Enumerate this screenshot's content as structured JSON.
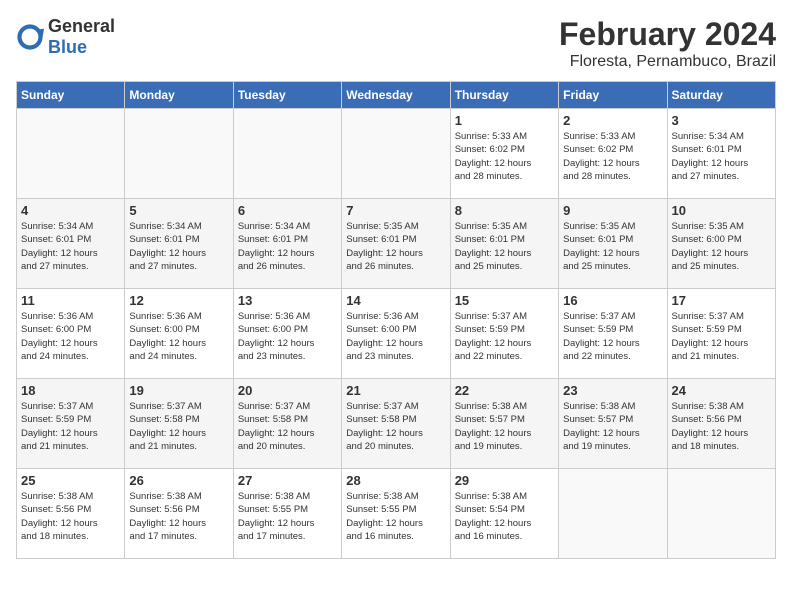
{
  "header": {
    "logo_general": "General",
    "logo_blue": "Blue",
    "month_year": "February 2024",
    "location": "Floresta, Pernambuco, Brazil"
  },
  "days_of_week": [
    "Sunday",
    "Monday",
    "Tuesday",
    "Wednesday",
    "Thursday",
    "Friday",
    "Saturday"
  ],
  "weeks": [
    [
      {
        "day": "",
        "info": ""
      },
      {
        "day": "",
        "info": ""
      },
      {
        "day": "",
        "info": ""
      },
      {
        "day": "",
        "info": ""
      },
      {
        "day": "1",
        "info": "Sunrise: 5:33 AM\nSunset: 6:02 PM\nDaylight: 12 hours\nand 28 minutes."
      },
      {
        "day": "2",
        "info": "Sunrise: 5:33 AM\nSunset: 6:02 PM\nDaylight: 12 hours\nand 28 minutes."
      },
      {
        "day": "3",
        "info": "Sunrise: 5:34 AM\nSunset: 6:01 PM\nDaylight: 12 hours\nand 27 minutes."
      }
    ],
    [
      {
        "day": "4",
        "info": "Sunrise: 5:34 AM\nSunset: 6:01 PM\nDaylight: 12 hours\nand 27 minutes."
      },
      {
        "day": "5",
        "info": "Sunrise: 5:34 AM\nSunset: 6:01 PM\nDaylight: 12 hours\nand 27 minutes."
      },
      {
        "day": "6",
        "info": "Sunrise: 5:34 AM\nSunset: 6:01 PM\nDaylight: 12 hours\nand 26 minutes."
      },
      {
        "day": "7",
        "info": "Sunrise: 5:35 AM\nSunset: 6:01 PM\nDaylight: 12 hours\nand 26 minutes."
      },
      {
        "day": "8",
        "info": "Sunrise: 5:35 AM\nSunset: 6:01 PM\nDaylight: 12 hours\nand 25 minutes."
      },
      {
        "day": "9",
        "info": "Sunrise: 5:35 AM\nSunset: 6:01 PM\nDaylight: 12 hours\nand 25 minutes."
      },
      {
        "day": "10",
        "info": "Sunrise: 5:35 AM\nSunset: 6:00 PM\nDaylight: 12 hours\nand 25 minutes."
      }
    ],
    [
      {
        "day": "11",
        "info": "Sunrise: 5:36 AM\nSunset: 6:00 PM\nDaylight: 12 hours\nand 24 minutes."
      },
      {
        "day": "12",
        "info": "Sunrise: 5:36 AM\nSunset: 6:00 PM\nDaylight: 12 hours\nand 24 minutes."
      },
      {
        "day": "13",
        "info": "Sunrise: 5:36 AM\nSunset: 6:00 PM\nDaylight: 12 hours\nand 23 minutes."
      },
      {
        "day": "14",
        "info": "Sunrise: 5:36 AM\nSunset: 6:00 PM\nDaylight: 12 hours\nand 23 minutes."
      },
      {
        "day": "15",
        "info": "Sunrise: 5:37 AM\nSunset: 5:59 PM\nDaylight: 12 hours\nand 22 minutes."
      },
      {
        "day": "16",
        "info": "Sunrise: 5:37 AM\nSunset: 5:59 PM\nDaylight: 12 hours\nand 22 minutes."
      },
      {
        "day": "17",
        "info": "Sunrise: 5:37 AM\nSunset: 5:59 PM\nDaylight: 12 hours\nand 21 minutes."
      }
    ],
    [
      {
        "day": "18",
        "info": "Sunrise: 5:37 AM\nSunset: 5:59 PM\nDaylight: 12 hours\nand 21 minutes."
      },
      {
        "day": "19",
        "info": "Sunrise: 5:37 AM\nSunset: 5:58 PM\nDaylight: 12 hours\nand 21 minutes."
      },
      {
        "day": "20",
        "info": "Sunrise: 5:37 AM\nSunset: 5:58 PM\nDaylight: 12 hours\nand 20 minutes."
      },
      {
        "day": "21",
        "info": "Sunrise: 5:37 AM\nSunset: 5:58 PM\nDaylight: 12 hours\nand 20 minutes."
      },
      {
        "day": "22",
        "info": "Sunrise: 5:38 AM\nSunset: 5:57 PM\nDaylight: 12 hours\nand 19 minutes."
      },
      {
        "day": "23",
        "info": "Sunrise: 5:38 AM\nSunset: 5:57 PM\nDaylight: 12 hours\nand 19 minutes."
      },
      {
        "day": "24",
        "info": "Sunrise: 5:38 AM\nSunset: 5:56 PM\nDaylight: 12 hours\nand 18 minutes."
      }
    ],
    [
      {
        "day": "25",
        "info": "Sunrise: 5:38 AM\nSunset: 5:56 PM\nDaylight: 12 hours\nand 18 minutes."
      },
      {
        "day": "26",
        "info": "Sunrise: 5:38 AM\nSunset: 5:56 PM\nDaylight: 12 hours\nand 17 minutes."
      },
      {
        "day": "27",
        "info": "Sunrise: 5:38 AM\nSunset: 5:55 PM\nDaylight: 12 hours\nand 17 minutes."
      },
      {
        "day": "28",
        "info": "Sunrise: 5:38 AM\nSunset: 5:55 PM\nDaylight: 12 hours\nand 16 minutes."
      },
      {
        "day": "29",
        "info": "Sunrise: 5:38 AM\nSunset: 5:54 PM\nDaylight: 12 hours\nand 16 minutes."
      },
      {
        "day": "",
        "info": ""
      },
      {
        "day": "",
        "info": ""
      }
    ]
  ]
}
